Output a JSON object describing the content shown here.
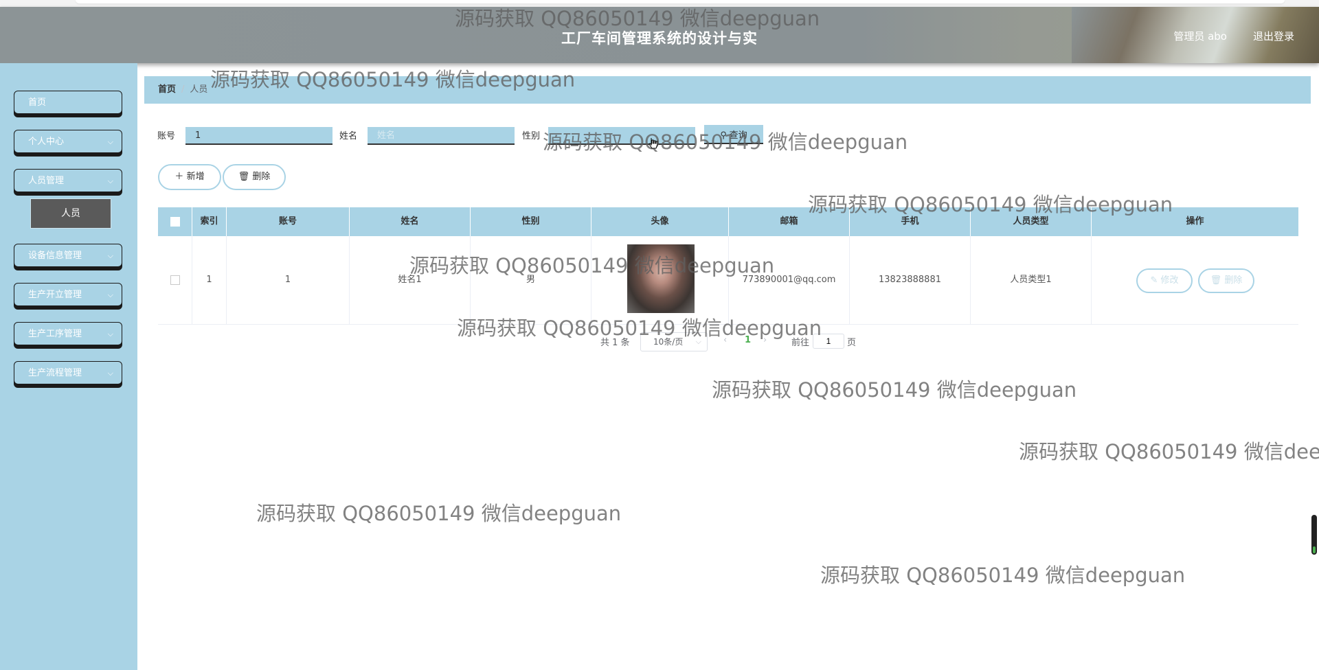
{
  "header": {
    "title": "工厂车间管理系统的设计与实",
    "user": "管理员 abo",
    "logout": "退出登录"
  },
  "sidebar": {
    "items": [
      {
        "label": "首页"
      },
      {
        "label": "个人中心"
      },
      {
        "label": "人员管理"
      },
      {
        "label": "设备信息管理"
      },
      {
        "label": "生产开立管理"
      },
      {
        "label": "生产工序管理"
      },
      {
        "label": "生产流程管理"
      }
    ],
    "submenu_active": "人员"
  },
  "breadcrumb": {
    "home": "首页",
    "current": "人员"
  },
  "search": {
    "account_label": "账号",
    "account_value": "1",
    "name_label": "姓名",
    "name_placeholder": "姓名",
    "gender_label": "性别",
    "query_button": "查询"
  },
  "actions": {
    "add": "新增",
    "delete": "删除"
  },
  "table": {
    "headers": [
      "索引",
      "账号",
      "姓名",
      "性别",
      "头像",
      "邮箱",
      "手机",
      "人员类型",
      "操作"
    ],
    "rows": [
      {
        "index": "1",
        "account": "1",
        "name": "姓名1",
        "gender": "男",
        "email": "773890001@qq.com",
        "phone": "13823888881",
        "type": "人员类型1",
        "edit": "修改",
        "delete": "删除"
      }
    ]
  },
  "pagination": {
    "total": "共 1 条",
    "page_size": "10条/页",
    "current_page": "1",
    "goto_label": "前往",
    "goto_value": "1",
    "page_suffix": "页"
  },
  "watermark": "源码获取 QQ86050149 微信deepguan",
  "colors": {
    "accent": "#a9d3e5",
    "header": "#8c9496",
    "submenu_active": "#5a5a5a"
  }
}
